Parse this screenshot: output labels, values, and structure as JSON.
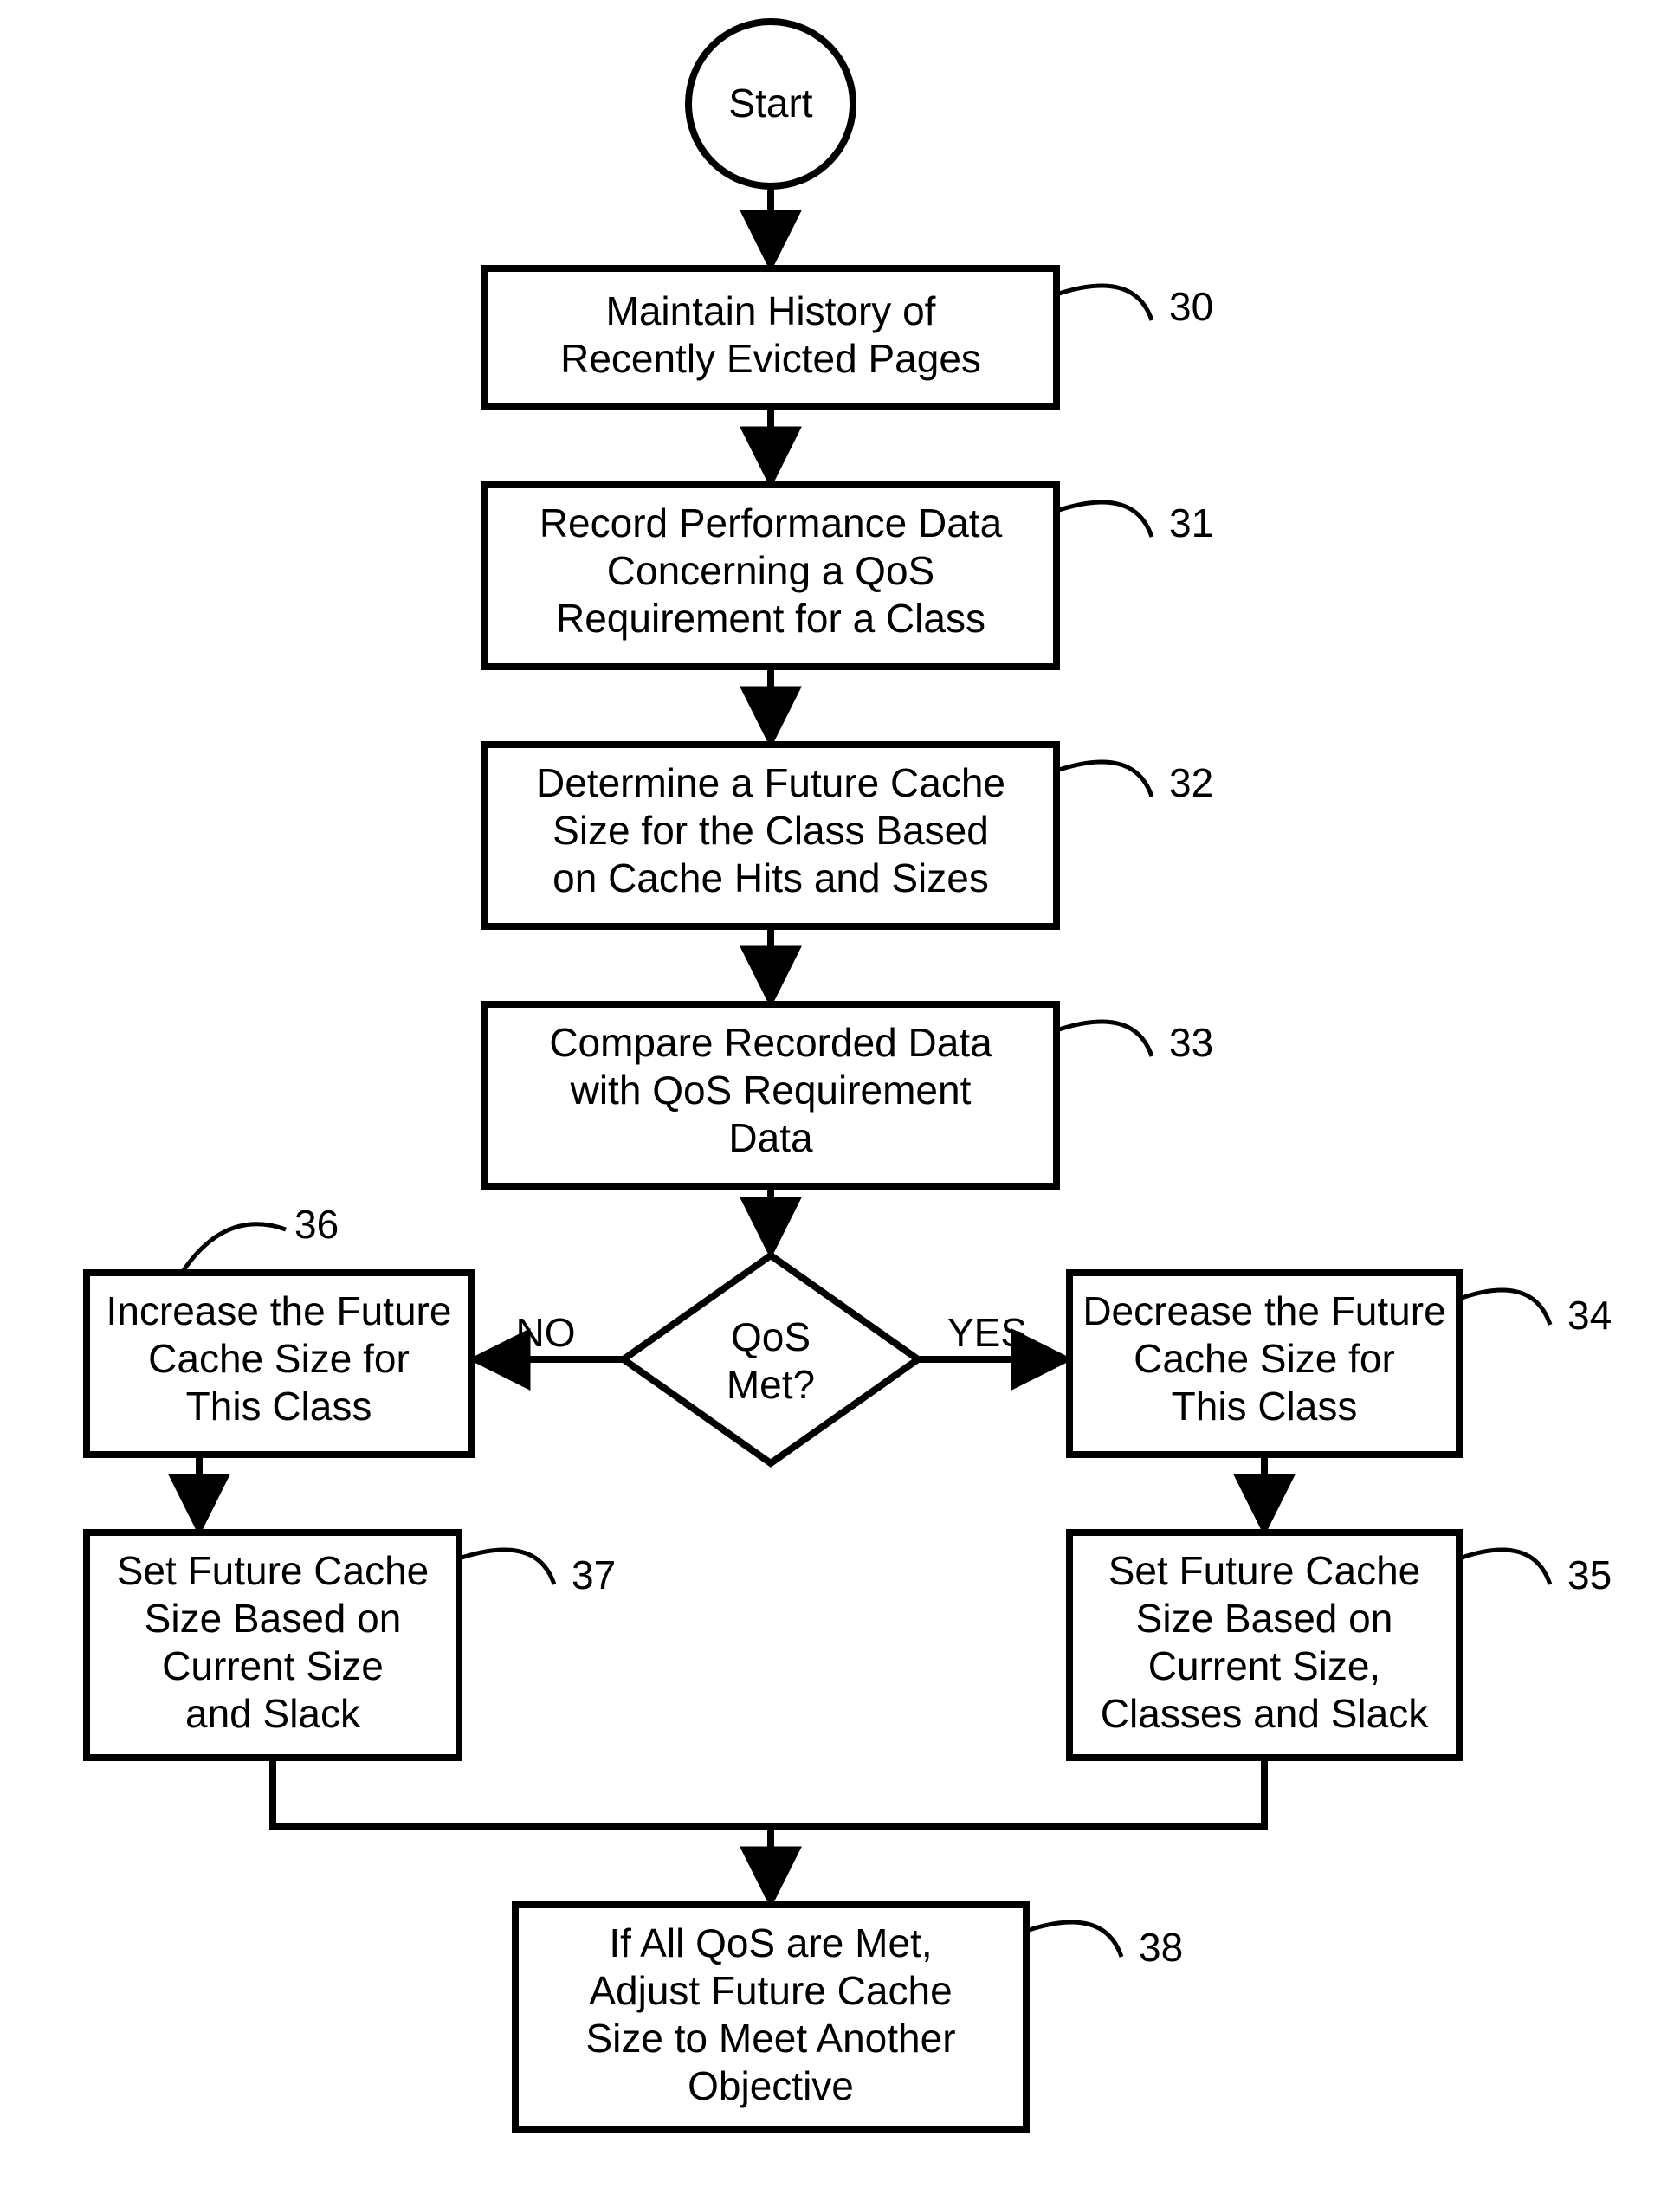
{
  "start": "Start",
  "boxes": {
    "b30": {
      "ref": "30",
      "lines": [
        "Maintain History of",
        "Recently Evicted Pages"
      ]
    },
    "b31": {
      "ref": "31",
      "lines": [
        "Record Performance Data",
        "Concerning a QoS",
        "Requirement for a Class"
      ]
    },
    "b32": {
      "ref": "32",
      "lines": [
        "Determine a Future Cache",
        "Size for the Class Based",
        "on Cache Hits and Sizes"
      ]
    },
    "b33": {
      "ref": "33",
      "lines": [
        "Compare Recorded Data",
        "with QoS Requirement",
        "Data"
      ]
    },
    "b34": {
      "ref": "34",
      "lines": [
        "Decrease the Future",
        "Cache Size for",
        "This Class"
      ]
    },
    "b35": {
      "ref": "35",
      "lines": [
        "Set Future Cache",
        "Size Based on",
        "Current Size,",
        "Classes and Slack"
      ]
    },
    "b36": {
      "ref": "36",
      "lines": [
        "Increase the Future",
        "Cache Size for",
        "This Class"
      ]
    },
    "b37": {
      "ref": "37",
      "lines": [
        "Set Future Cache",
        "Size Based on",
        "Current Size",
        "and Slack"
      ]
    },
    "b38": {
      "ref": "38",
      "lines": [
        "If All QoS are Met,",
        "Adjust Future Cache",
        "Size to Meet Another",
        "Objective"
      ]
    }
  },
  "decision": {
    "lines": [
      "QoS",
      "Met?"
    ],
    "no": "NO",
    "yes": "YES"
  }
}
